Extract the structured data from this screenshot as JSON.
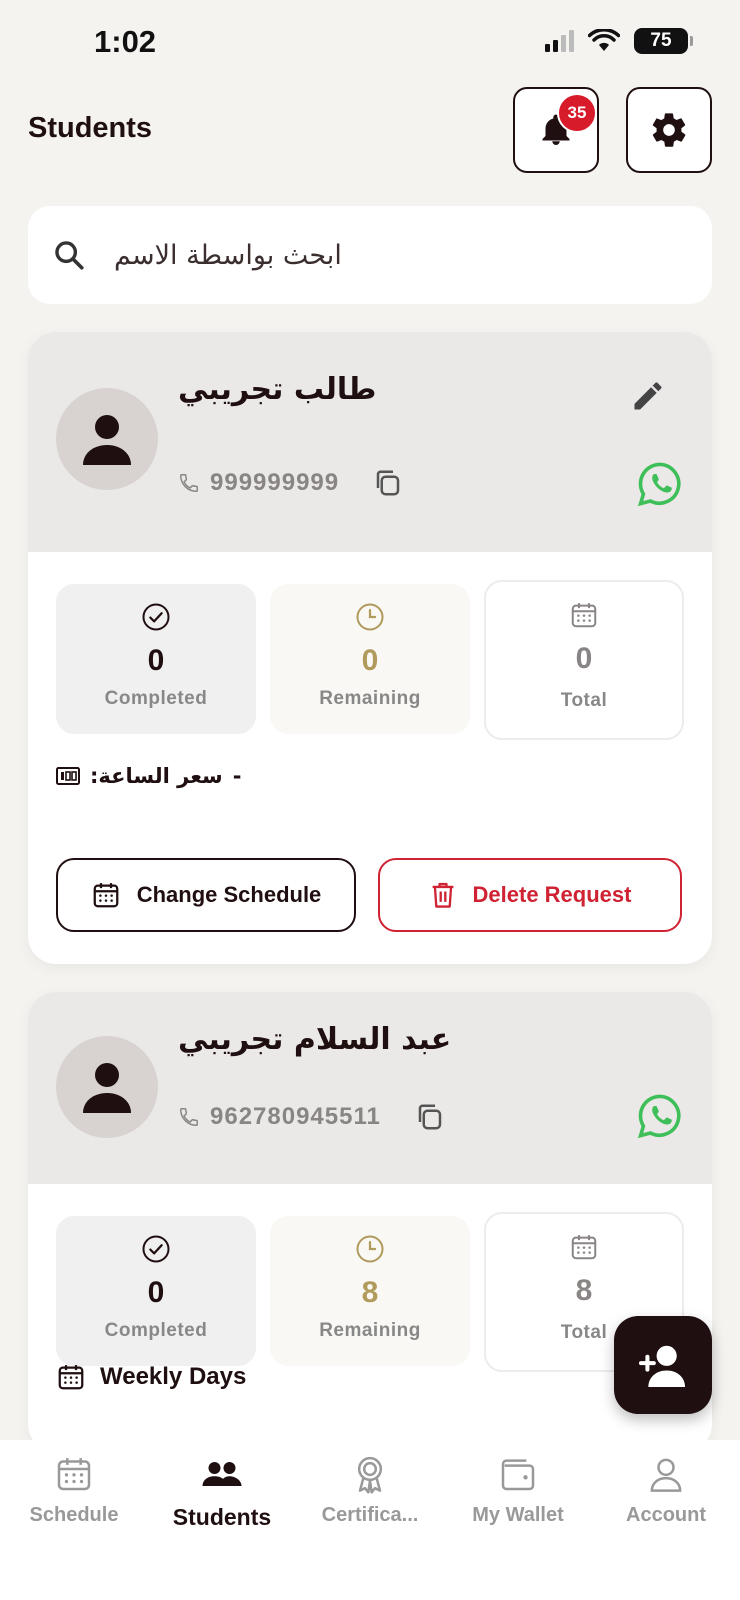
{
  "status_bar": {
    "time": "1:02",
    "battery": "75"
  },
  "header": {
    "title": "Students",
    "notification_count": "35"
  },
  "search": {
    "placeholder": "ابحث بواسطة الاسم"
  },
  "students": [
    {
      "name": "طالب تجريبي",
      "phone": "999999999",
      "completed": "0",
      "remaining": "0",
      "total": "0",
      "hour_price_label": "سعر الساعة:",
      "hour_price_value": "-",
      "change_schedule_label": "Change Schedule",
      "delete_request_label": "Delete Request"
    },
    {
      "name": "عبد السلام تجريبي",
      "phone": "962780945511",
      "completed": "0",
      "remaining": "8",
      "total": "8",
      "weekly_days_label": "Weekly Days"
    }
  ],
  "stat_labels": {
    "completed": "Completed",
    "remaining": "Remaining",
    "total": "Total"
  },
  "tabbar": [
    {
      "label": "Schedule",
      "icon": "calendar-icon",
      "active": false
    },
    {
      "label": "Students",
      "icon": "students-icon",
      "active": true
    },
    {
      "label": "Certifica...",
      "icon": "certificate-icon",
      "active": false
    },
    {
      "label": "My Wallet",
      "icon": "wallet-icon",
      "active": false
    },
    {
      "label": "Account",
      "icon": "account-icon",
      "active": false
    }
  ],
  "colors": {
    "primary": "#1f0f10",
    "danger": "#cf2233",
    "gold": "#b09a5c",
    "whatsapp": "#3fbf5a",
    "badge": "#d81b2b"
  }
}
